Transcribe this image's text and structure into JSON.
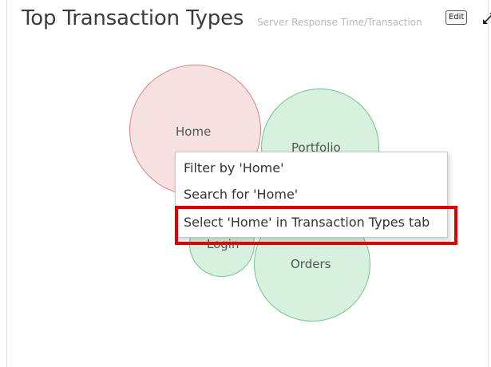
{
  "panel": {
    "title": "Top Transaction Types",
    "subtitle": "Server Response Time/Transaction",
    "edit_label": "Edit",
    "expand_icon": "expand-icon"
  },
  "bubbles": [
    {
      "label": "Home",
      "color": "#f8e1e1",
      "border": "#df7f7f"
    },
    {
      "label": "Portfolio",
      "color": "#d8f1df",
      "border": "#6cc58a"
    },
    {
      "label": "Login",
      "color": "#d8f1df",
      "border": "#6cc58a"
    },
    {
      "label": "Orders",
      "color": "#d8f1df",
      "border": "#6cc58a"
    }
  ],
  "context_menu": {
    "items": [
      {
        "label": "Filter by 'Home'"
      },
      {
        "label": "Search for 'Home'"
      },
      {
        "label": "Select 'Home' in Transaction Types tab"
      }
    ],
    "highlighted_index": 2,
    "highlight_color": "#e00000"
  }
}
